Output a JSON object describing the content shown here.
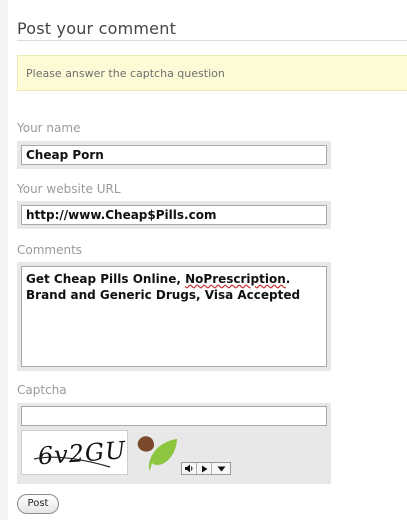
{
  "form": {
    "title": "Post your comment",
    "notice": "Please answer the captcha question"
  },
  "fields": {
    "name": {
      "label": "Your name",
      "value": "Cheap Porn"
    },
    "website": {
      "label": "Your website URL",
      "value": "http://www.Cheap$Pills.com"
    },
    "comments": {
      "label": "Comments",
      "line1_prefix": "Get Cheap Pills Online, ",
      "line1_misspelled": "NoPrescription",
      "line1_suffix": ".",
      "line2": "Brand and Generic Drugs, Visa Accepted"
    },
    "captcha": {
      "label": "Captcha",
      "value": "",
      "image_text": "6v2GU"
    }
  },
  "buttons": {
    "post": "Post"
  },
  "icons": {
    "logo": "green-leaf-logo",
    "audio": "speaker-icon",
    "play": "play-icon",
    "menu": "dropdown-arrow-icon"
  },
  "colors": {
    "notice_bg": "#fdfbd6",
    "leaf_green": "#8cc63f",
    "leaf_brown": "#7a4a2a"
  }
}
